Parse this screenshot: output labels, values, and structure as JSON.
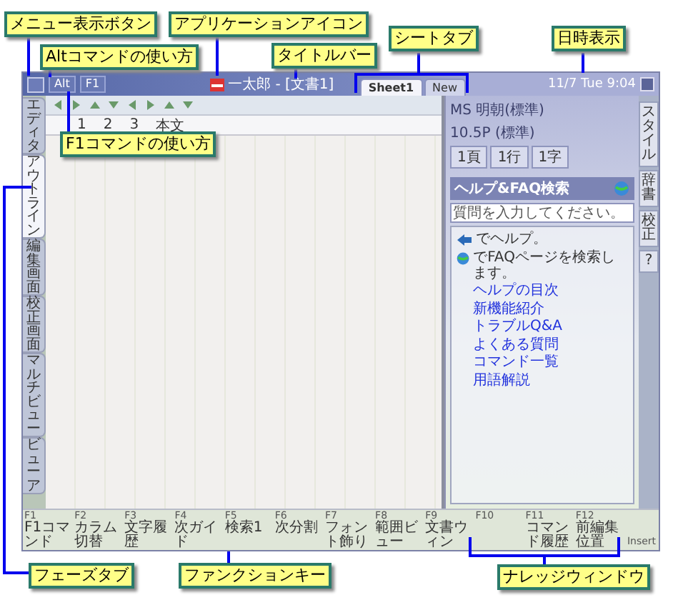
{
  "callouts": [
    {
      "text": "メニュー表示ボタン"
    },
    {
      "text": "Altコマンドの使い方"
    },
    {
      "text": "アプリケーションアイコン"
    },
    {
      "text": "タイトルバー"
    },
    {
      "text": "シートタブ"
    },
    {
      "text": "日時表示"
    },
    {
      "text": "F1コマンドの使い方"
    },
    {
      "text": "フェーズタブ"
    },
    {
      "text": "ファンクションキー"
    },
    {
      "text": "ナレッジウィンドウ"
    }
  ],
  "title_bar": {
    "buttons": [
      "Alt",
      "F1"
    ],
    "title": "一太郎 - [文書1]",
    "sheet_tabs": [
      {
        "label": "Sheet1",
        "selected": true
      },
      {
        "label": "New",
        "selected": false
      }
    ],
    "datetime": "11/7 Tue 9:04"
  },
  "ruler": [
    "1",
    "2",
    "3",
    "本文"
  ],
  "phase_tabs": [
    {
      "label": "エディタ",
      "selected": false
    },
    {
      "label": "アウトライン",
      "selected": true
    },
    {
      "label": "編集画面",
      "selected": false
    },
    {
      "label": "校正画面",
      "selected": false
    },
    {
      "label": "マルチビュー",
      "selected": false
    },
    {
      "label": "ビューア",
      "selected": false
    }
  ],
  "knowledge": {
    "font": "MS 明朝(標準)",
    "size": "10.5P (標準)",
    "position": [
      "1頁",
      "1行",
      "1字"
    ],
    "search_title": "ヘルプ&FAQ検索",
    "search_placeholder": "質問を入力してください。",
    "actions": [
      "でヘルプ。",
      "でFAQページを検索します。"
    ],
    "links": [
      "ヘルプの目次",
      "新機能紹介",
      "トラブルQ&A",
      "よくある質問",
      "コマンド一覧",
      "用語解説"
    ]
  },
  "side_tabs": [
    "スタイル",
    "辞書",
    "校正",
    "?"
  ],
  "function_keys": [
    {
      "key": "F1",
      "label": "F1コマンド"
    },
    {
      "key": "F2",
      "label": "カラム切替"
    },
    {
      "key": "F3",
      "label": "文字履歴"
    },
    {
      "key": "F4",
      "label": "次ガイド"
    },
    {
      "key": "F5",
      "label": "検索1"
    },
    {
      "key": "F6",
      "label": "次分割"
    },
    {
      "key": "F7",
      "label": "フォント飾り"
    },
    {
      "key": "F8",
      "label": "範囲ビュー"
    },
    {
      "key": "F9",
      "label": "文書ウィン"
    },
    {
      "key": "F10"
    },
    {
      "key": "F11",
      "label": "コマンド履歴"
    },
    {
      "key": "F12",
      "label": "前編集位置"
    }
  ],
  "status": "Insert"
}
